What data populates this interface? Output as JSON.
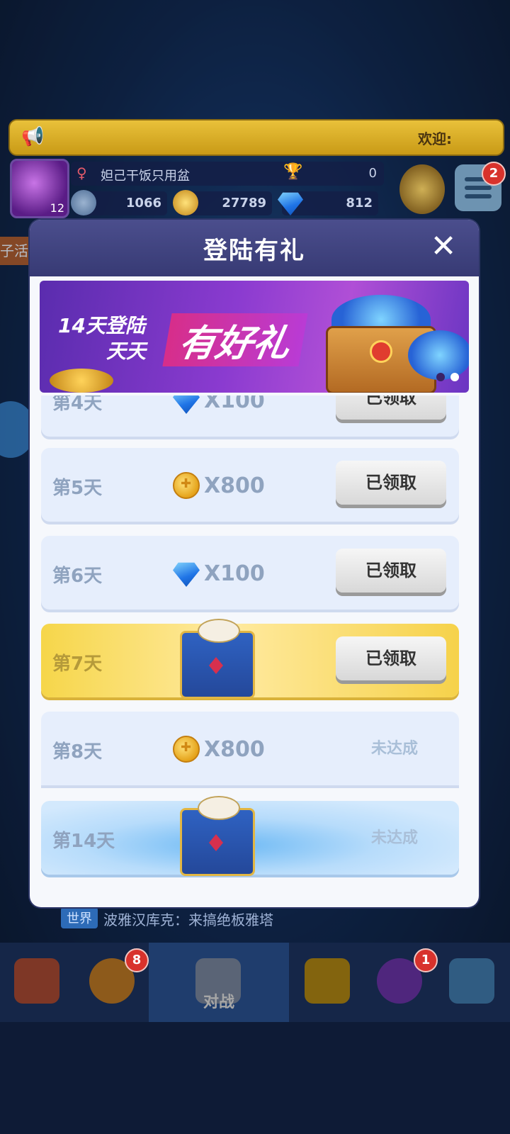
{
  "top": {
    "welcome_text": "欢迎:",
    "player_name": "妲己干饭只用盆",
    "trophy_count": "0",
    "level": "12",
    "resources": {
      "stamina": "1066",
      "coins": "27789",
      "gems": "812"
    },
    "menu_badge": "2",
    "side_label": "子活"
  },
  "modal": {
    "title": "登陆有礼",
    "close_icon": "close-icon",
    "promo": {
      "line1": "14天登陆",
      "line2": "天天",
      "headline": "有好礼"
    },
    "rows": [
      {
        "day": "第4天",
        "reward_type": "gem",
        "amount": "X100",
        "action": "已领取",
        "state": "claimed"
      },
      {
        "day": "第5天",
        "reward_type": "coin",
        "amount": "X800",
        "action": "已领取",
        "state": "claimed"
      },
      {
        "day": "第6天",
        "reward_type": "gem",
        "amount": "X100",
        "action": "已领取",
        "state": "claimed"
      },
      {
        "day": "第7天",
        "reward_type": "gift",
        "amount": "",
        "action": "已领取",
        "state": "claimed"
      },
      {
        "day": "第8天",
        "reward_type": "coin",
        "amount": "X800",
        "action": "未达成",
        "state": "locked"
      },
      {
        "day": "第14天",
        "reward_type": "gift",
        "amount": "",
        "action": "未达成",
        "state": "locked"
      }
    ]
  },
  "chat": {
    "channel": "世界",
    "message": "波雅汉库克：来搞绝板雅塔"
  },
  "nav": {
    "battle_label": "对战",
    "badge_pack": "8",
    "badge_planet": "1"
  },
  "colors": {
    "modal_header": "#3f4280",
    "gold_row": "#f6d64a",
    "claimed_button": "#e8e8e8"
  }
}
